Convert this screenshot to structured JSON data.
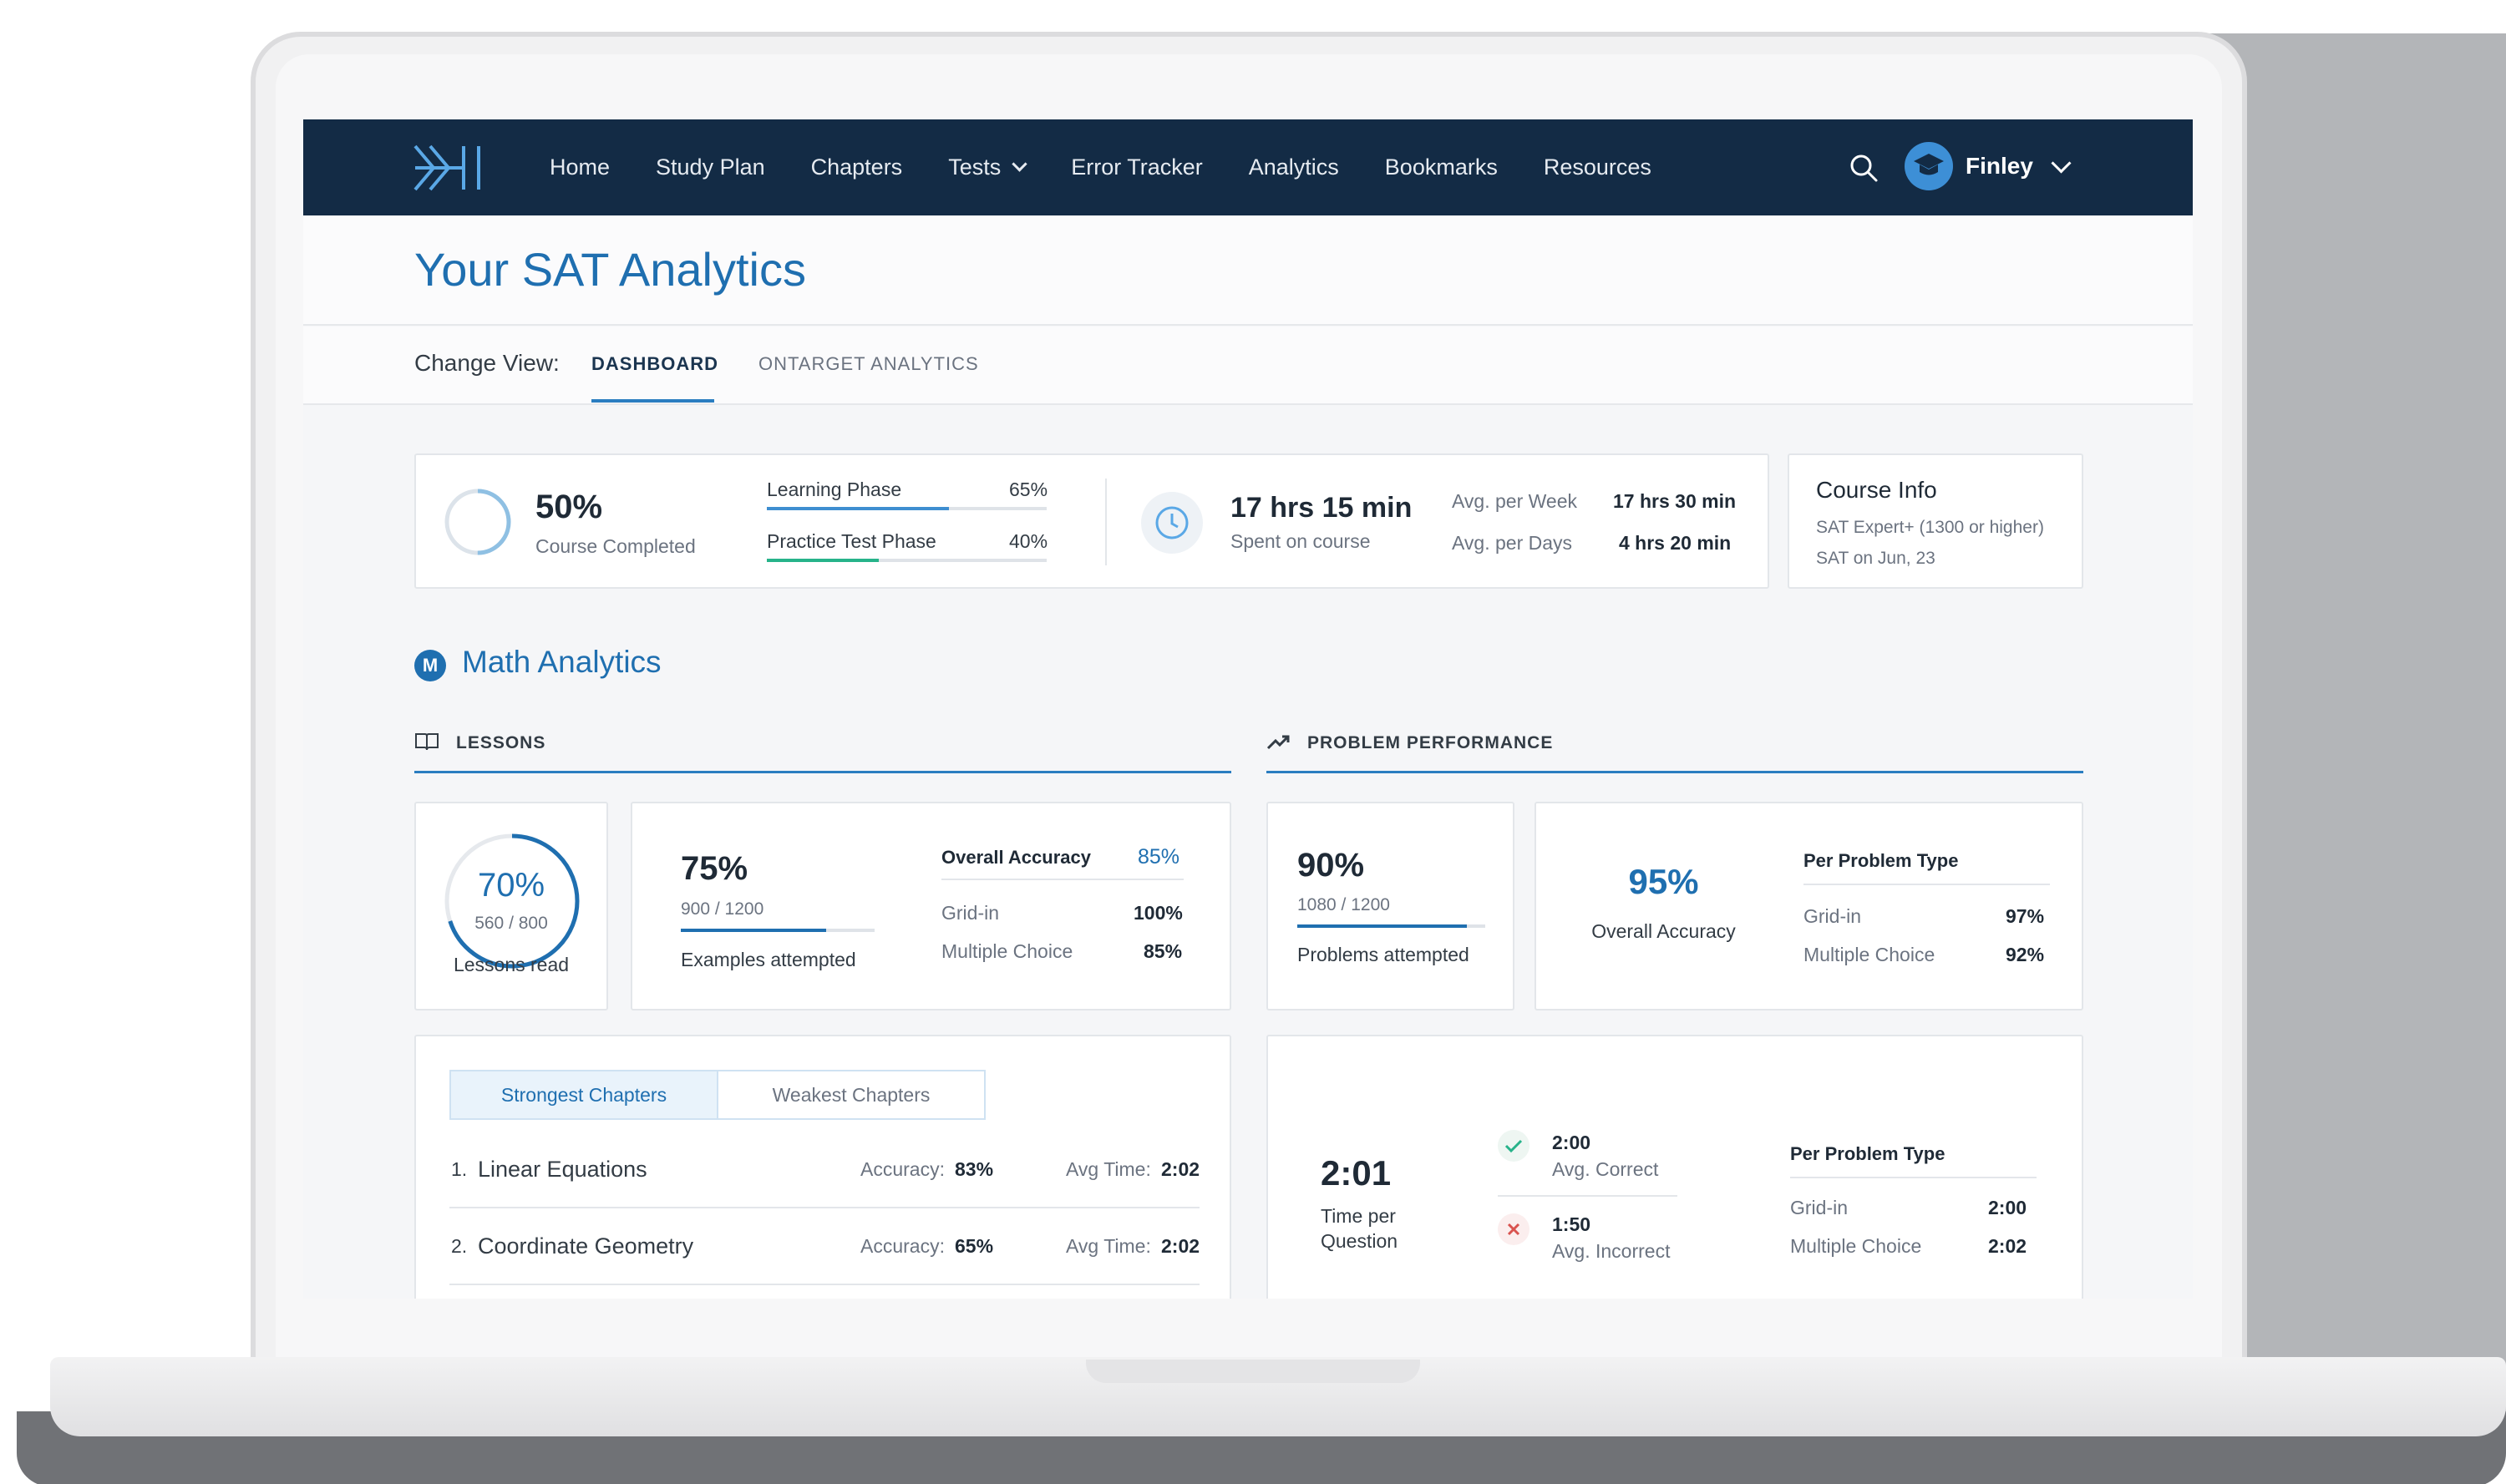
{
  "nav": {
    "links": [
      "Home",
      "Study Plan",
      "Chapters",
      "Tests",
      "Error Tracker",
      "Analytics",
      "Bookmarks",
      "Resources"
    ],
    "user_name": "Finley"
  },
  "page_title": "Your SAT Analytics",
  "view": {
    "label": "Change View:",
    "tabs": [
      "DASHBOARD",
      "ONTARGET ANALYTICS"
    ],
    "active_tab": "DASHBOARD"
  },
  "summary": {
    "course_percent": "50%",
    "course_progress": 0.5,
    "course_label": "Course Completed",
    "phases": [
      {
        "label": "Learning Phase",
        "value": "65%",
        "progress": 0.65,
        "color": "#3e8ed0"
      },
      {
        "label": "Practice Test Phase",
        "value": "40%",
        "progress": 0.4,
        "color": "#27b38a"
      }
    ],
    "time_spent": "17 hrs 15 min",
    "time_label": "Spent on course",
    "averages": [
      {
        "label": "Avg. per Week",
        "value": "17 hrs 30 min"
      },
      {
        "label": "Avg. per Days",
        "value": "4 hrs 20 min"
      }
    ]
  },
  "course_info": {
    "title": "Course Info",
    "lines": [
      "SAT Expert+ (1300 or higher)",
      "SAT on Jun, 23"
    ]
  },
  "math": {
    "badge": "M",
    "title": "Math Analytics",
    "lessons_header": "LESSONS",
    "performance_header": "PROBLEM PERFORMANCE",
    "lessons_read": {
      "percent": "70%",
      "progress": 0.7,
      "count": "560 / 800",
      "label": "Lessons read"
    },
    "examples": {
      "percent": "75%",
      "progress": 0.75,
      "count": "900 / 1200",
      "label": "Examples attempted"
    },
    "example_accuracy": {
      "title": "Overall Accuracy",
      "value": "85%",
      "rows": [
        {
          "label": "Grid-in",
          "value": "100%"
        },
        {
          "label": "Multiple Choice",
          "value": "85%"
        }
      ]
    },
    "problems": {
      "percent": "90%",
      "progress": 0.9,
      "count": "1080 / 1200",
      "label": "Problems attempted"
    },
    "problem_accuracy": {
      "value": "95%",
      "label": "Overall Accuracy"
    },
    "per_problem_type": {
      "title": "Per Problem Type",
      "rows": [
        {
          "label": "Grid-in",
          "value": "97%"
        },
        {
          "label": "Multiple Choice",
          "value": "92%"
        }
      ]
    },
    "chapters": {
      "tabs": [
        "Strongest Chapters",
        "Weakest Chapters"
      ],
      "active_tab": "Strongest Chapters",
      "accuracy_label": "Accuracy:",
      "time_label": "Avg Time:",
      "rows": [
        {
          "rank": "1.",
          "name": "Linear Equations",
          "accuracy": "83%",
          "time": "2:02"
        },
        {
          "rank": "2.",
          "name": "Coordinate Geometry",
          "accuracy": "65%",
          "time": "2:02"
        }
      ]
    },
    "timing": {
      "value": "2:01",
      "label_line1": "Time per",
      "label_line2": "Question",
      "correct": {
        "value": "2:00",
        "label": "Avg. Correct"
      },
      "incorrect": {
        "value": "1:50",
        "label": "Avg. Incorrect"
      },
      "per_type_title": "Per Problem Type",
      "rows": [
        {
          "label": "Grid-in",
          "value": "2:00"
        },
        {
          "label": "Multiple Choice",
          "value": "2:02"
        }
      ]
    }
  },
  "colors": {
    "nav_bg": "#132b45",
    "accent": "#1f6fb0",
    "success": "#27b38a",
    "error": "#d9534f"
  }
}
